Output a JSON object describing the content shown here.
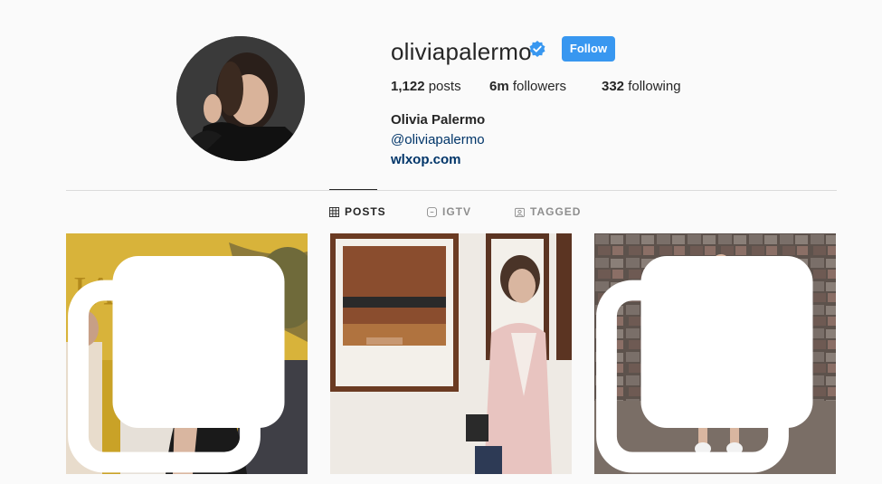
{
  "profile": {
    "username": "oliviapalermo",
    "verified": true,
    "follow_label": "Follow",
    "stats": {
      "posts_count": "1,122",
      "posts_label": "posts",
      "followers_count": "6m",
      "followers_label": "followers",
      "following_count": "332",
      "following_label": "following"
    },
    "full_name": "Olivia Palermo",
    "handle": "@oliviapalermo",
    "website": "wlxop.com"
  },
  "tabs": [
    {
      "label": "POSTS",
      "icon": "grid-icon",
      "active": true
    },
    {
      "label": "IGTV",
      "icon": "igtv-icon",
      "active": false
    },
    {
      "label": "TAGGED",
      "icon": "tagged-icon",
      "active": false
    }
  ],
  "posts": [
    {
      "description_icon": "photo",
      "multi": true,
      "sign_text": "IAGET"
    },
    {
      "description_icon": "photo",
      "multi": false
    },
    {
      "description_icon": "photo",
      "multi": true
    }
  ],
  "colors": {
    "accent": "#3897f0",
    "link": "#003569",
    "text": "#262626",
    "muted": "#8e8e8e",
    "background": "#fafafa"
  }
}
